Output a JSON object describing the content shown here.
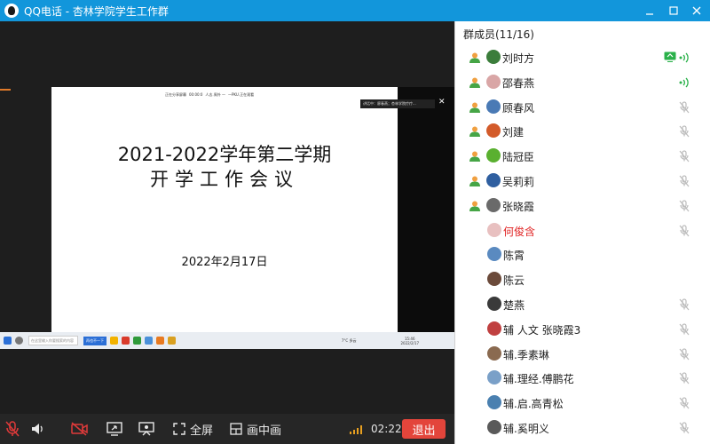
{
  "window": {
    "title": "QQ电话 - 杏林学院学生工作群",
    "controls": [
      "minimize-icon",
      "maximize-icon",
      "close-icon"
    ]
  },
  "shared_screen": {
    "header_items": [
      "正在分享屏幕",
      "00:00:0",
      "人志.周外 —",
      "—PKU.正在观看"
    ],
    "speaker_label": "讲话中：廖春燕；杏林学院疗疗...",
    "title_line1": "2021-2022学年第二学期",
    "title_line2": "开学工作会议",
    "date": "2022年2月17日",
    "taskbar": {
      "search_placeholder": "在这里输入你要搜索的内容",
      "task_button": "再也不一下",
      "weather": "7°C 多云",
      "clock_time": "15:46",
      "clock_date": "2022/2/17"
    }
  },
  "toolbar": {
    "fullscreen_label": "全屏",
    "pip_label": "画中画",
    "call_time": "02:22",
    "exit_label": "退出"
  },
  "members": {
    "header": "群成员(11/16)",
    "list": [
      {
        "name": "刘时方",
        "status": "speaking",
        "screen": true,
        "icon": "user-icon",
        "color": "#3b7d3b"
      },
      {
        "name": "邵春燕",
        "status": "speaking",
        "screen": false,
        "icon": "user-icon",
        "color": "#d9a6a6"
      },
      {
        "name": "顾春风",
        "status": "muted",
        "screen": false,
        "icon": "user-icon",
        "color": "#4a7ab5"
      },
      {
        "name": "刘建",
        "status": "muted",
        "screen": false,
        "icon": "user-icon",
        "color": "#d35b2a"
      },
      {
        "name": "陆冠臣",
        "status": "muted",
        "screen": false,
        "icon": "user-icon",
        "color": "#5ab030"
      },
      {
        "name": "吴莉莉",
        "status": "muted",
        "screen": false,
        "icon": "user-icon",
        "color": "#2f5fa0"
      },
      {
        "name": "张晓霞",
        "status": "muted",
        "screen": false,
        "icon": "user-icon",
        "color": "#6a6a6a"
      },
      {
        "name": "何俊含",
        "status": "muted",
        "screen": false,
        "icon": "",
        "color": "#e8c0c0",
        "highlight": true
      },
      {
        "name": "陈霄",
        "status": "none",
        "screen": false,
        "icon": "",
        "color": "#5a8ac0"
      },
      {
        "name": "陈云",
        "status": "none",
        "screen": false,
        "icon": "",
        "color": "#6b4a3a"
      },
      {
        "name": "楚燕",
        "status": "muted",
        "screen": false,
        "icon": "",
        "color": "#3a3a3a"
      },
      {
        "name": "辅 人文 张晓霞3",
        "status": "muted",
        "screen": false,
        "icon": "",
        "color": "#c04040"
      },
      {
        "name": "辅.季素琳",
        "status": "muted",
        "screen": false,
        "icon": "",
        "color": "#8a6a50"
      },
      {
        "name": "辅.理经.傅鹏花",
        "status": "muted",
        "screen": false,
        "icon": "",
        "color": "#7aa0c8"
      },
      {
        "name": "辅.启.高青松",
        "status": "muted",
        "screen": false,
        "icon": "",
        "color": "#4a80b0"
      },
      {
        "name": "辅.奚明义",
        "status": "muted",
        "screen": false,
        "icon": "",
        "color": "#5a5a5a"
      }
    ]
  },
  "colors": {
    "titlebar": "#1296db",
    "exit_button": "#e3453b",
    "muted_mic": "#e03a3a",
    "speaking": "#2ab14a",
    "highlight_name": "#e02020"
  }
}
